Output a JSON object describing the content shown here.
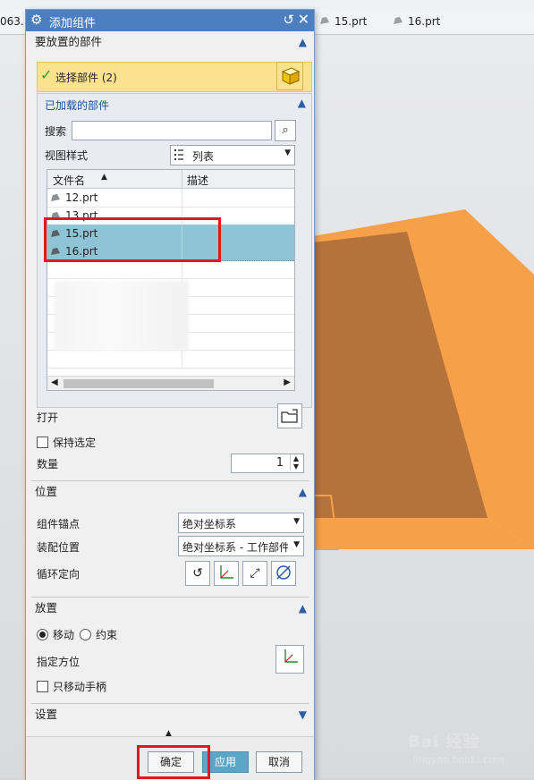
{
  "background": {
    "file_tabs": [
      {
        "label": "063."
      },
      {
        "label": "15.prt"
      },
      {
        "label": "16.prt"
      }
    ],
    "model_color": "#f6a14a",
    "model_face_color": "#b5733b"
  },
  "dialog": {
    "title": "添加组件",
    "sections": {
      "parts": {
        "heading": "要放置的部件",
        "select_label": "选择部件 (2)",
        "loaded": {
          "heading": "已加载的部件",
          "search_label": "搜索",
          "search_value": "",
          "view_style_label": "视图样式",
          "view_style_value": "列表",
          "columns": [
            "文件名",
            "描述"
          ],
          "rows": [
            {
              "name": "12.prt",
              "desc": "",
              "selected": false
            },
            {
              "name": "13.prt",
              "desc": "",
              "selected": false
            },
            {
              "name": "15.prt",
              "desc": "",
              "selected": true
            },
            {
              "name": "16.prt",
              "desc": "",
              "selected": true
            }
          ]
        },
        "open_label": "打开",
        "keep_selected_label": "保持选定",
        "keep_selected": false,
        "quantity_label": "数量",
        "quantity_value": "1"
      },
      "position": {
        "heading": "位置",
        "anchor_label": "组件锚点",
        "anchor_value": "绝对坐标系",
        "assembly_pos_label": "装配位置",
        "assembly_pos_value": "绝对坐标系 - 工作部件",
        "cycle_label": "循环定向"
      },
      "placement": {
        "heading": "放置",
        "move_label": "移动",
        "constraint_label": "约束",
        "selected_mode": "move",
        "orientation_label": "指定方位",
        "move_handles_label": "只移动手柄",
        "move_handles": false
      },
      "settings": {
        "heading": "设置"
      }
    },
    "buttons": {
      "ok": "确定",
      "apply": "应用",
      "cancel": "取消"
    },
    "accent_color": "#4b7fc0",
    "highlight_color": "#e01a1a"
  },
  "watermark": {
    "brand": "Bai 经验",
    "url": "jingyan.baidu.com"
  }
}
